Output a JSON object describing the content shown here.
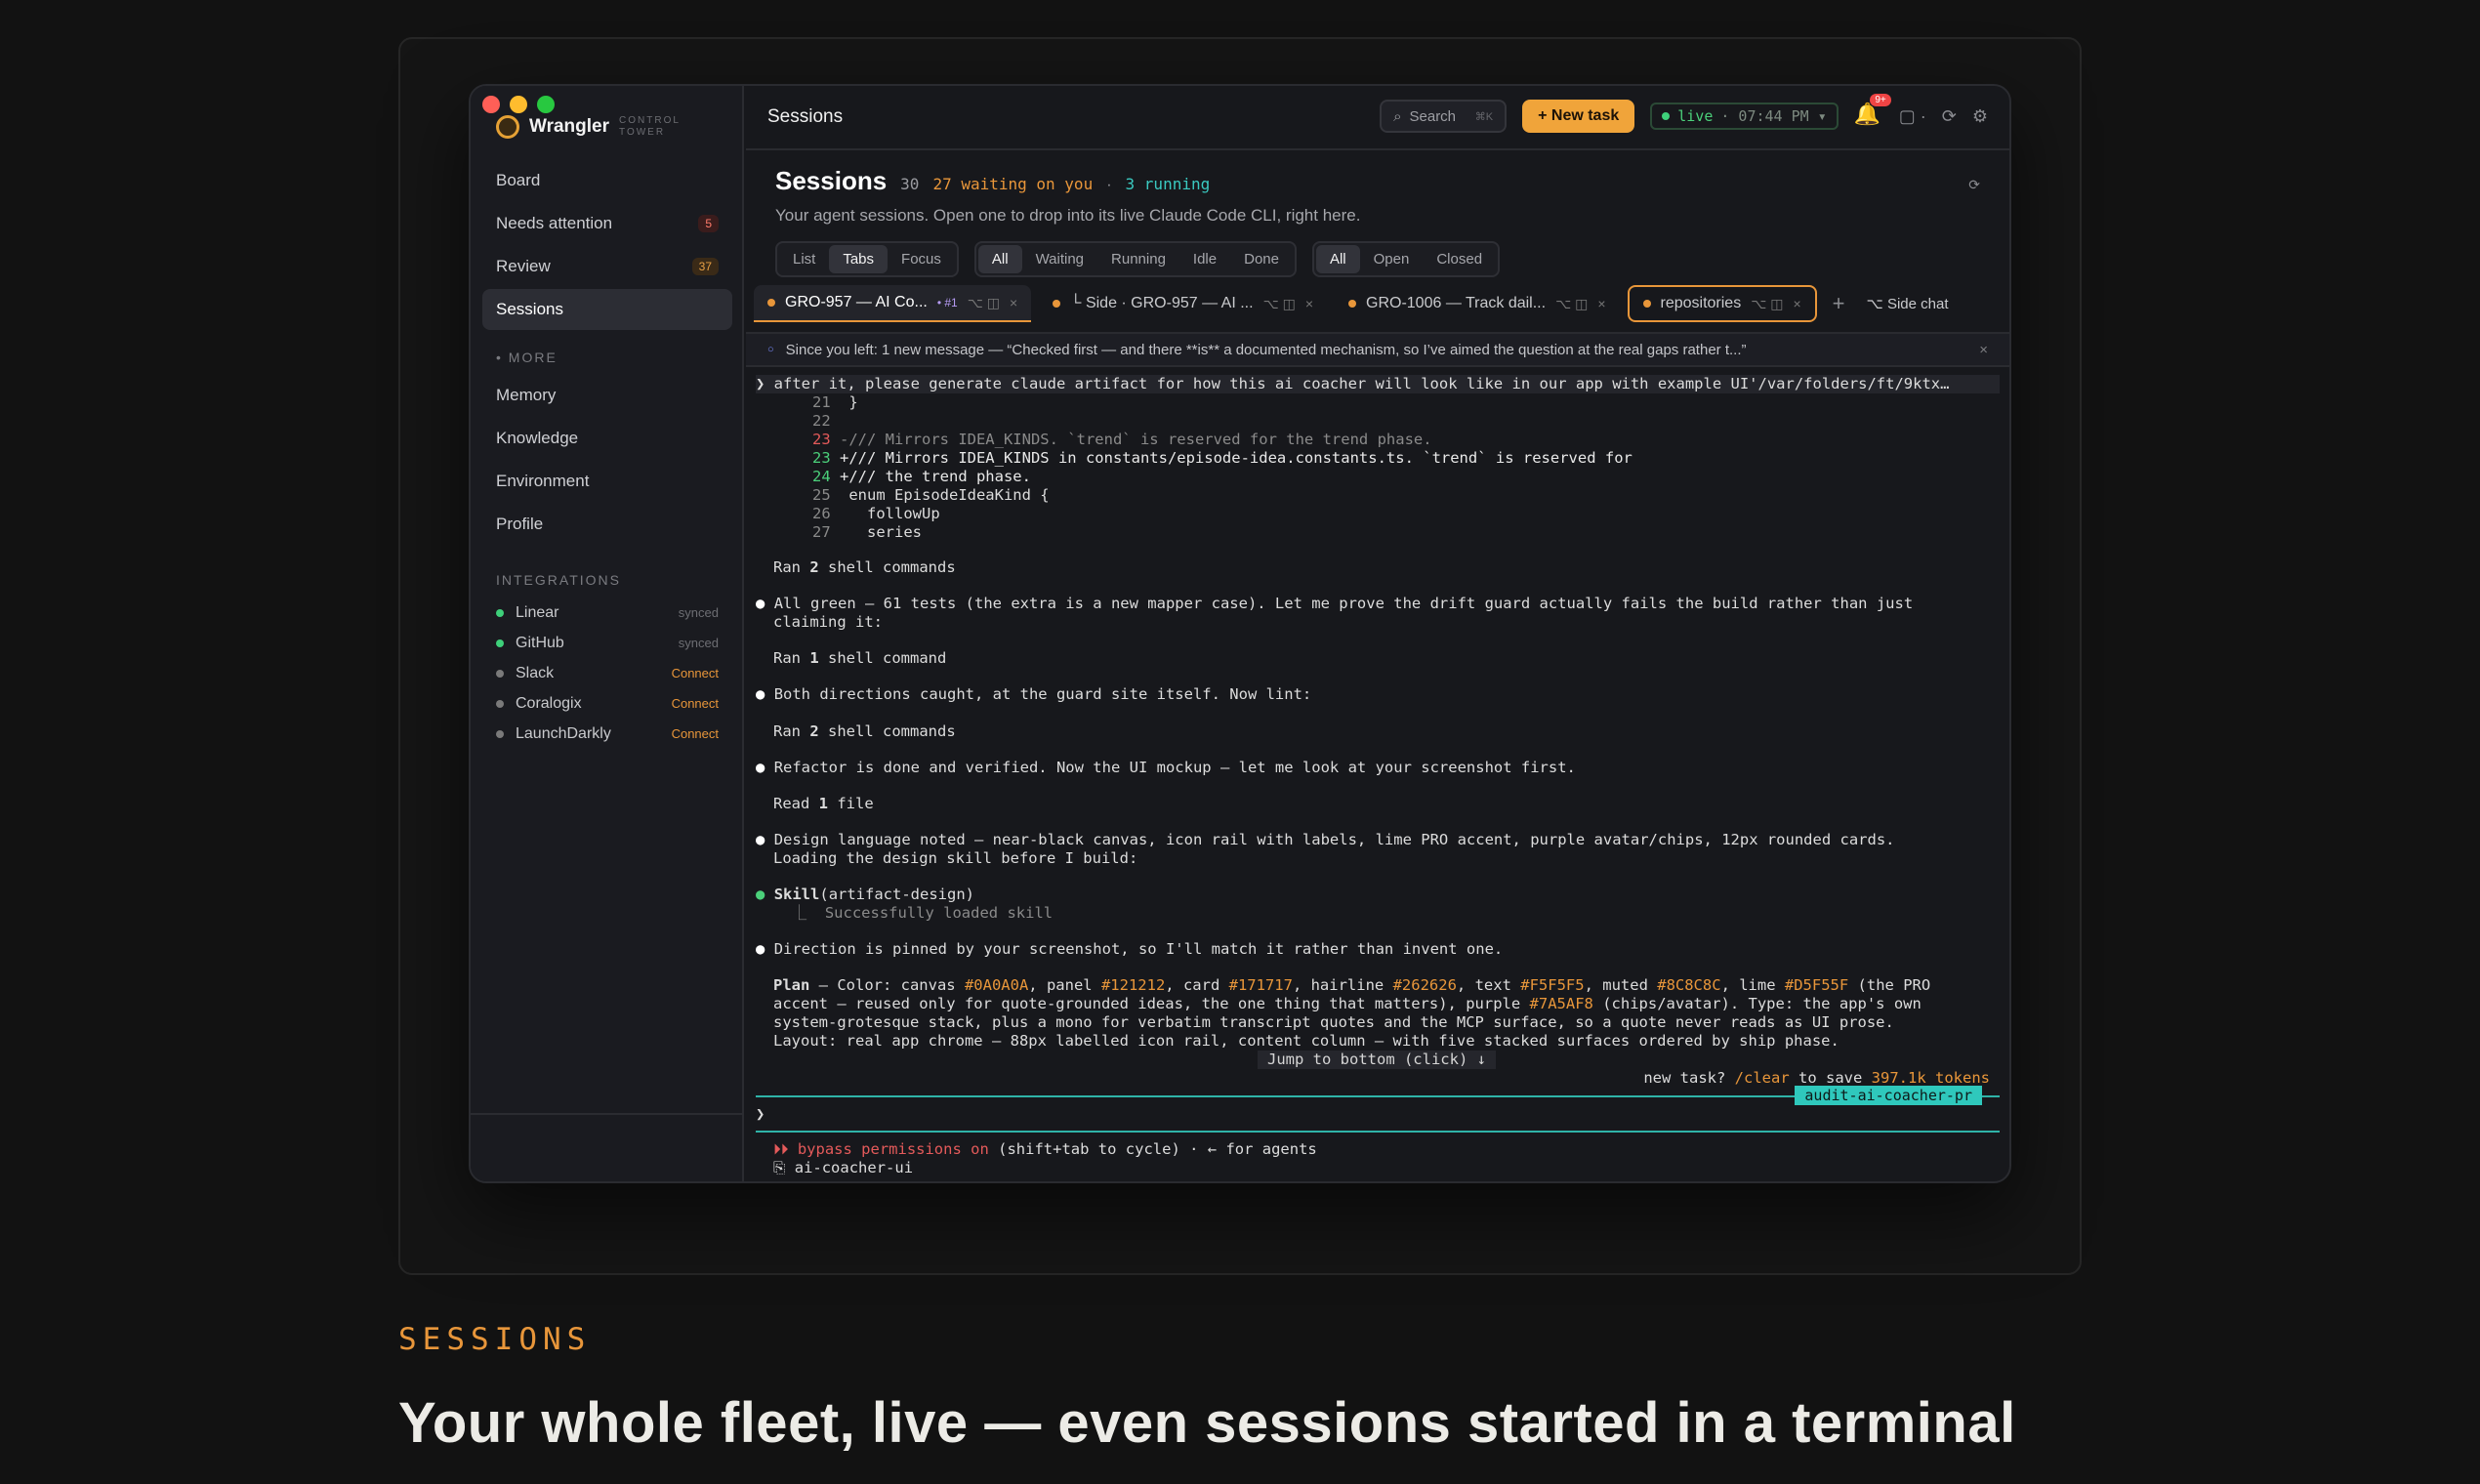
{
  "sidebar": {
    "app_name": "Wrangler",
    "app_tagline": "CONTROL TOWER",
    "nav": [
      {
        "label": "Board",
        "badge": ""
      },
      {
        "label": "Needs attention",
        "badge": "5"
      },
      {
        "label": "Review",
        "badge": "37"
      },
      {
        "label": "Sessions",
        "badge": ""
      }
    ],
    "more_label": "MORE",
    "more": [
      "Memory",
      "Knowledge",
      "Environment",
      "Profile"
    ],
    "integrations_label": "INTEGRATIONS",
    "integrations": [
      {
        "name": "Linear",
        "status": "synced",
        "color": "#3ed07a"
      },
      {
        "name": "GitHub",
        "status": "synced",
        "color": "#3ed07a"
      },
      {
        "name": "Slack",
        "status": "Connect",
        "color": "#7a7a7a"
      },
      {
        "name": "Coralogix",
        "status": "Connect",
        "color": "#7a7a7a"
      },
      {
        "name": "LaunchDarkly",
        "status": "Connect",
        "color": "#7a7a7a"
      }
    ]
  },
  "topbar": {
    "title": "Sessions",
    "search": "Search",
    "search_kbd": "⌘K",
    "new_task": "+ New task",
    "live": "live",
    "time": "· 07:44 PM ▾",
    "notif_count": "9+"
  },
  "header": {
    "title": "Sessions",
    "count": "30",
    "waiting": "27 waiting on you",
    "sep": "·",
    "running": "3 running",
    "subtitle": "Your agent sessions. Open one to drop into its live Claude Code CLI, right here.",
    "view_filters": [
      "List",
      "Tabs",
      "Focus"
    ],
    "status_filters": [
      "All",
      "Waiting",
      "Running",
      "Idle",
      "Done"
    ],
    "state_filters": [
      "All",
      "Open",
      "Closed"
    ]
  },
  "tabs": [
    {
      "label": "GRO-957 — AI Co...",
      "num": "• #1"
    },
    {
      "label": "└ Side · GRO-957 — AI ..."
    },
    {
      "label": "GRO-1006 — Track dail..."
    },
    {
      "label": "repositories"
    }
  ],
  "side_chat": "⌥ Side chat",
  "notice": "Since you left: 1 new message — “Checked first — and there **is** a documented mechanism, so I’ve aimed the question at the real gaps rather t...”",
  "terminal": {
    "prompt": "❯ after it, please generate claude artifact for how this ai coacher will look like in our app with example UI'/var/folders/ft/9ktx…",
    "diff": [
      {
        "n": "21",
        "sign": "",
        "text": " }"
      },
      {
        "n": "22",
        "sign": "",
        "text": ""
      },
      {
        "n": "23",
        "sign": "-",
        "text": "/// Mirrors IDEA_KINDS. `trend` is reserved for the trend phase."
      },
      {
        "n": "23",
        "sign": "+",
        "text": "/// Mirrors IDEA_KINDS in constants/episode-idea.constants.ts. `trend` is reserved for"
      },
      {
        "n": "24",
        "sign": "+",
        "text": "/// the trend phase."
      },
      {
        "n": "25",
        "sign": "",
        "text": " enum EpisodeIdeaKind {"
      },
      {
        "n": "26",
        "sign": "",
        "text": "   followUp"
      },
      {
        "n": "27",
        "sign": "",
        "text": "   series"
      }
    ],
    "ran1_a": "Ran ",
    "ran1_b": "2",
    "ran1_c": " shell commands",
    "b1": "All green — 61 tests (the extra is a new mapper case). Let me prove the drift guard actually fails the build rather than just",
    "b1b": "claiming it:",
    "ran2_a": "Ran ",
    "ran2_b": "1",
    "ran2_c": " shell command",
    "b2": "Both directions caught, at the guard site itself. Now lint:",
    "ran3_a": "Ran ",
    "ran3_b": "2",
    "ran3_c": " shell commands",
    "b3": "Refactor is done and verified. Now the UI mockup — let me look at your screenshot first.",
    "read_a": "Read ",
    "read_b": "1",
    "read_c": " file",
    "b4": "Design language noted — near-black canvas, icon rail with labels, lime PRO accent, purple avatar/chips, 12px rounded cards.",
    "b4b": "Loading the design skill before I build:",
    "skill": "Skill",
    "skill_arg": "(artifact-design)",
    "skill_ok": "  ⎿  Successfully loaded skill",
    "b5": "Direction is pinned by your screenshot, so I'll match it rather than invent one.",
    "plan_label": "Plan",
    "plan1a": " — Color: canvas ",
    "c1": "#0A0A0A",
    "p1": ", panel ",
    "c2": "#121212",
    "p2": ", card ",
    "c3": "#171717",
    "p3": ", hairline ",
    "c4": "#262626",
    "p4": ", text ",
    "c5": "#F5F5F5",
    "p5": ", muted ",
    "c6": "#8C8C8C",
    "p6": ", lime ",
    "c7": "#D5F55F",
    "p7": " (the PRO",
    "plan2a": "accent — reused only for quote-grounded ideas, the one thing that matters), purple ",
    "c8": "#7A5AF8",
    "plan2b": " (chips/avatar). Type: the app's own",
    "plan3": "system-grotesque stack, plus a mono for verbatim transcript quotes and the MCP surface, so a quote never reads as UI prose.",
    "plan4": "Layout: real app chrome — 88px labelled icon rail, content column — with five stacked surfaces ordered by ship phase.",
    "jump": "Jump to bottom (click) ↓",
    "newtask_a": "new task? ",
    "newtask_b": "/clear",
    "newtask_c": " to save ",
    "newtask_d": "397.1k tokens",
    "branch": "audit-ai-coacher-pr",
    "input_prompt": "❯",
    "bypass_a": "⏵⏵ bypass permissions on",
    "bypass_b": " (shift+tab to cycle) · ← for agents",
    "cwd": "⎘ ai-coacher-ui"
  },
  "below": {
    "kicker": "SESSIONS",
    "headline": "Your whole fleet, live — even sessions started in a terminal"
  }
}
